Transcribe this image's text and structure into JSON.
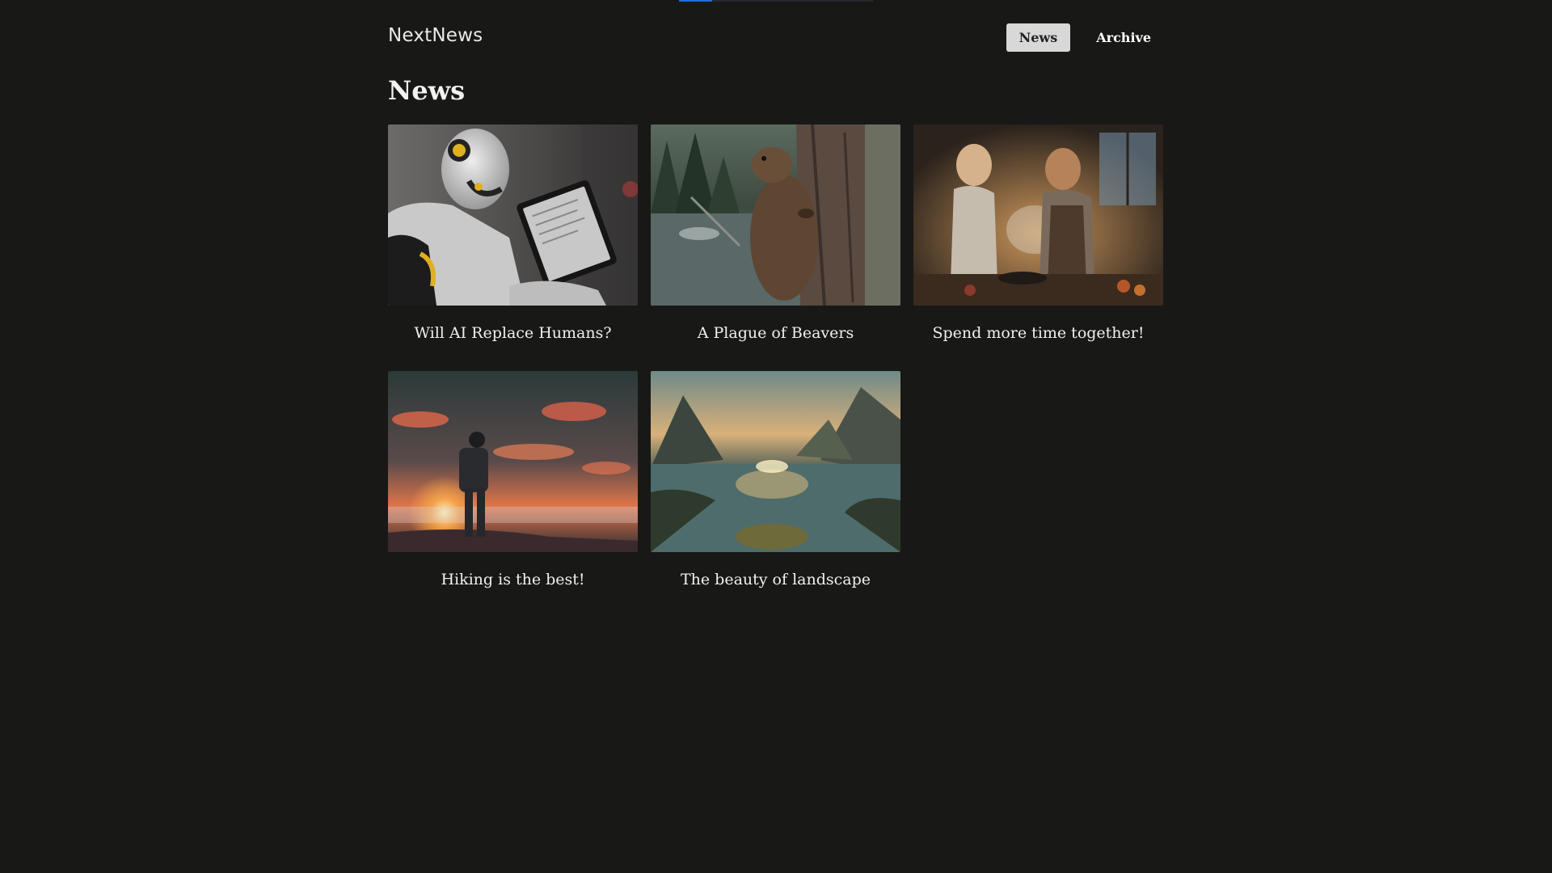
{
  "loading_progress": 0.17,
  "header": {
    "logo": "NextNews",
    "nav": [
      {
        "label": "News",
        "active": true
      },
      {
        "label": "Archive",
        "active": false
      }
    ]
  },
  "main": {
    "title": "News",
    "articles": [
      {
        "title": "Will AI Replace Humans?",
        "image": "robot-reading-tablet"
      },
      {
        "title": "A Plague of Beavers",
        "image": "beaver-on-tree"
      },
      {
        "title": "Spend more time together!",
        "image": "couple-cooking"
      },
      {
        "title": "Hiking is the best!",
        "image": "hiker-at-sunset"
      },
      {
        "title": "The beauty of landscape",
        "image": "mountain-lake"
      }
    ]
  },
  "colors": {
    "background": "#181817",
    "active_nav_bg": "#d8d8d8",
    "progress": "#1f6fd1"
  }
}
